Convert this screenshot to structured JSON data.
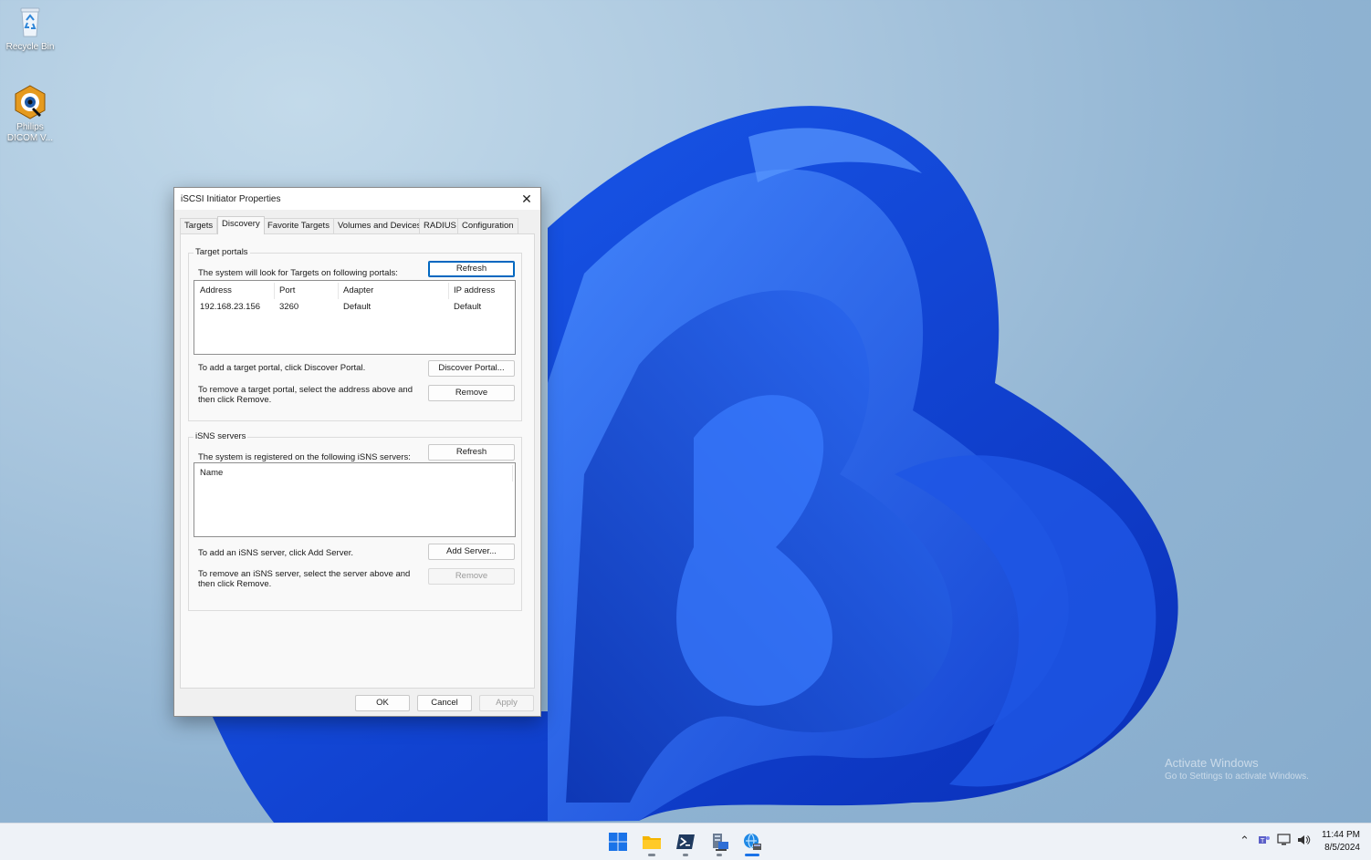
{
  "desktop": {
    "icons": [
      {
        "label": "Recycle Bin",
        "icon": "recycle-bin-icon"
      },
      {
        "label": "Philips DICOM V...",
        "icon": "philips-dicom-viewer-icon"
      }
    ],
    "watermark": {
      "line1": "Activate Windows",
      "line2": "Go to Settings to activate Windows."
    }
  },
  "dialog": {
    "title": "iSCSI Initiator Properties",
    "tabs": [
      {
        "label": "Targets"
      },
      {
        "label": "Discovery",
        "active": true
      },
      {
        "label": "Favorite Targets"
      },
      {
        "label": "Volumes and Devices"
      },
      {
        "label": "RADIUS"
      },
      {
        "label": "Configuration"
      }
    ],
    "target_portals": {
      "legend": "Target portals",
      "info": "The system will look for Targets on following portals:",
      "refresh_label": "Refresh",
      "columns": [
        "Address",
        "Port",
        "Adapter",
        "IP address"
      ],
      "rows": [
        {
          "address": "192.168.23.156",
          "port": "3260",
          "adapter": "Default",
          "ip": "Default"
        }
      ],
      "add_text": "To add a target portal, click Discover Portal.",
      "discover_label": "Discover Portal...",
      "remove_text_1": "To remove a target portal, select the address above and",
      "remove_text_2": "then click Remove.",
      "remove_label": "Remove"
    },
    "isns_servers": {
      "legend": "iSNS servers",
      "info": "The system is registered on the following iSNS servers:",
      "refresh_label": "Refresh",
      "columns": [
        "Name"
      ],
      "add_text": "To add an iSNS server, click Add Server.",
      "add_label": "Add Server...",
      "remove_text_1": "To remove an iSNS server, select the server above and",
      "remove_text_2": "then click Remove.",
      "remove_label": "Remove"
    },
    "footer": {
      "ok": "OK",
      "cancel": "Cancel",
      "apply": "Apply"
    }
  },
  "taskbar": {
    "apps": [
      "start-icon",
      "file-explorer-icon",
      "powershell-icon",
      "server-manager-icon",
      "iscsi-initiator-icon"
    ],
    "tray": [
      "chevron-up-icon",
      "teams-icon",
      "network-icon",
      "volume-icon"
    ],
    "time": "11:44 PM",
    "date": "8/5/2024"
  }
}
